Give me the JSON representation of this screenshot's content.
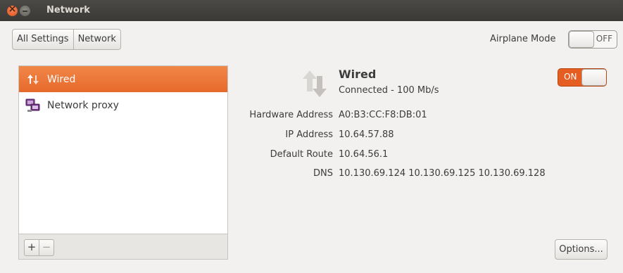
{
  "window": {
    "title": "Network"
  },
  "breadcrumb": {
    "items": [
      "All Settings",
      "Network"
    ]
  },
  "airplane": {
    "label": "Airplane Mode",
    "state": "OFF"
  },
  "connections": {
    "items": [
      {
        "label": "Wired",
        "icon": "wired-network-icon",
        "selected": true
      },
      {
        "label": "Network proxy",
        "icon": "network-proxy-icon",
        "selected": false
      }
    ],
    "add_label": "+",
    "remove_label": "−"
  },
  "details": {
    "title": "Wired",
    "status": "Connected - 100 Mb/s",
    "switch_state": "ON",
    "properties": [
      {
        "label": "Hardware Address",
        "value": "A0:B3:CC:F8:DB:01"
      },
      {
        "label": "IP Address",
        "value": "10.64.57.88"
      },
      {
        "label": "Default Route",
        "value": "10.64.56.1"
      },
      {
        "label": "DNS",
        "value": "10.130.69.124 10.130.69.125 10.130.69.128"
      }
    ]
  },
  "options": {
    "label": "Options..."
  },
  "colors": {
    "accent": "#e6692b",
    "titlebar": "#3c3b37",
    "background": "#f2f1f0"
  }
}
